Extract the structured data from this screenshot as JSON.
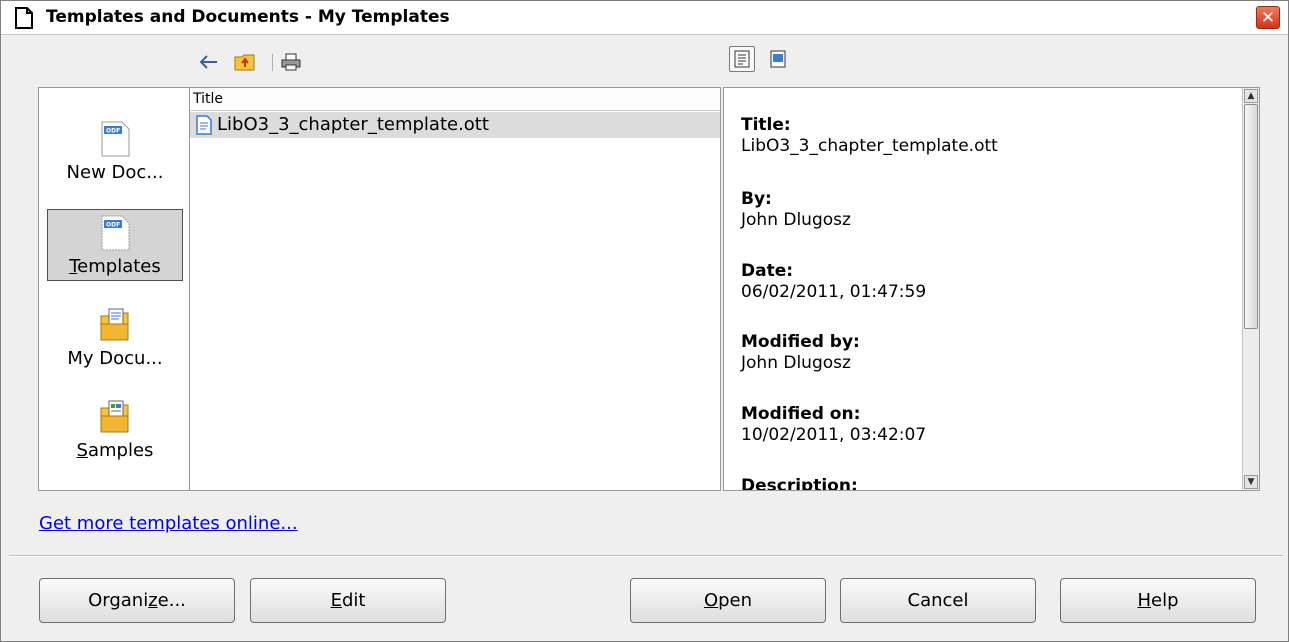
{
  "window": {
    "title": "Templates and Documents - My Templates",
    "close_label": "✕"
  },
  "toolbar": {
    "icons": [
      "back-icon",
      "folder-up-icon",
      "print-icon"
    ],
    "view_icons": [
      "document-properties-icon",
      "document-preview-icon"
    ]
  },
  "sidebar": {
    "items": [
      {
        "label": "New Doc...",
        "icon": "new-document-icon",
        "selected": false
      },
      {
        "label": "Templates",
        "mnemonic": "T",
        "rest": "emplates",
        "icon": "templates-icon",
        "selected": true
      },
      {
        "label": "My Docu...",
        "icon": "my-documents-folder-icon",
        "selected": false
      },
      {
        "label": "Samples",
        "mnemonic": "S",
        "rest": "amples",
        "icon": "samples-folder-icon",
        "selected": false
      }
    ]
  },
  "file_list": {
    "column_header": "Title",
    "files": [
      {
        "name": "LibO3_3_chapter_template.ott",
        "selected": true
      }
    ]
  },
  "properties": [
    {
      "key": "Title:",
      "value": "LibO3_3_chapter_template.ott"
    },
    {
      "key": "By:",
      "value": "John Dlugosz"
    },
    {
      "key": "Date:",
      "value": "06/02/2011, 01:47:59"
    },
    {
      "key": "Modified by:",
      "value": "John Dlugosz"
    },
    {
      "key": "Modified on:",
      "value": "10/02/2011, 03:42:07"
    },
    {
      "key": "Description:",
      "value": ""
    }
  ],
  "link": {
    "label": "Get more templates online..."
  },
  "buttons": {
    "organize": {
      "pre": "Organi",
      "mnemonic": "z",
      "post": "e..."
    },
    "edit": {
      "pre": "",
      "mnemonic": "E",
      "post": "dit"
    },
    "open": {
      "pre": "",
      "mnemonic": "O",
      "post": "pen"
    },
    "cancel": {
      "label": "Cancel"
    },
    "help": {
      "pre": "",
      "mnemonic": "H",
      "post": "elp"
    }
  },
  "colors": {
    "link": "#0000ee",
    "close_button": "#d2321a",
    "selection": "#dcdcdc"
  }
}
